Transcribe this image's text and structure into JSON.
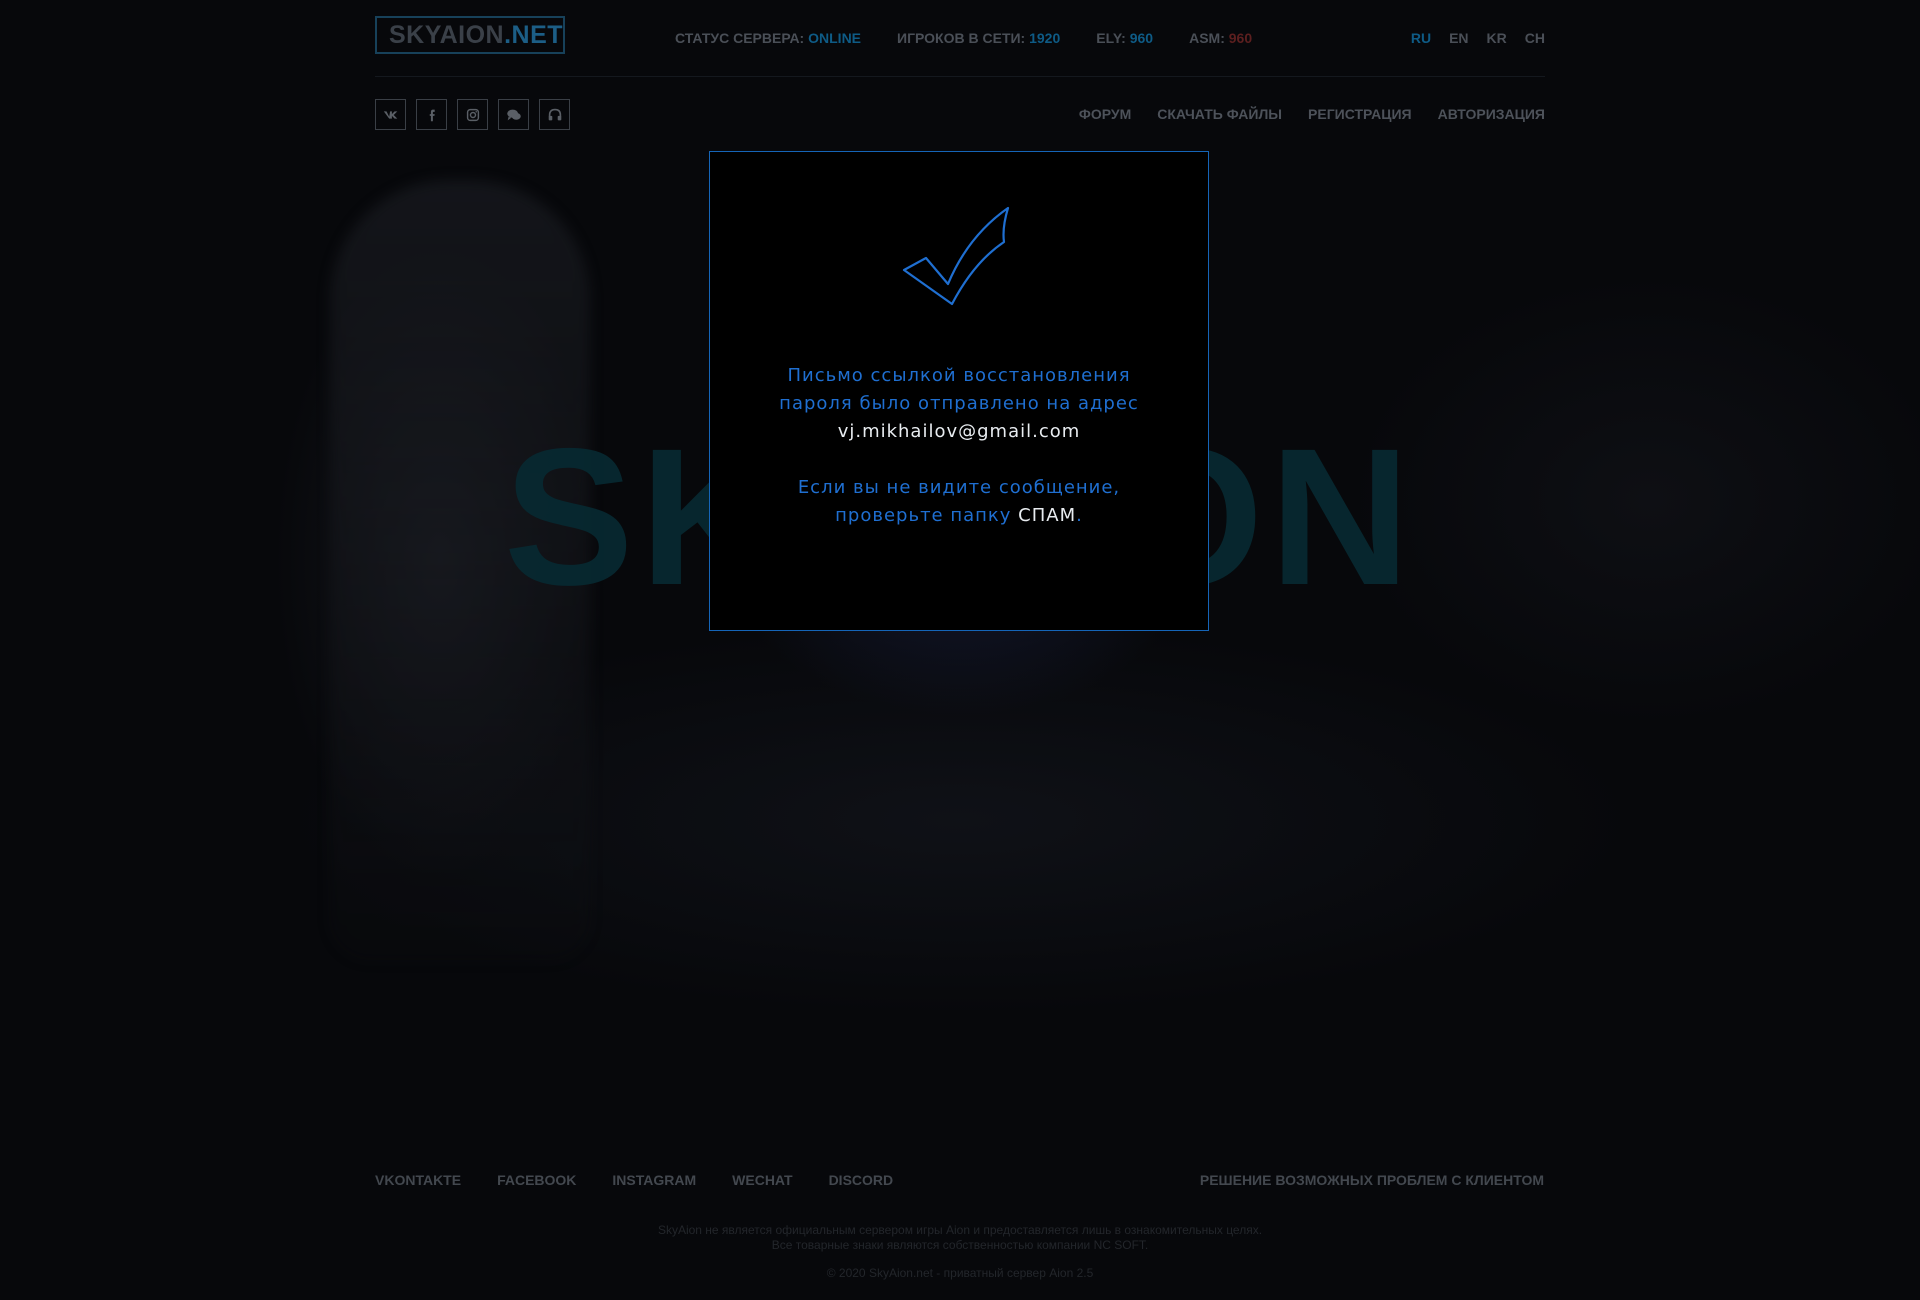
{
  "background": {
    "wordmark": "SKYAION"
  },
  "header": {
    "logo": {
      "main": "SKYAION",
      "suffix": ".NET"
    },
    "status": [
      {
        "label": "СТАТУС СЕРВЕРА:",
        "value": "ONLINE"
      },
      {
        "label": "ИГРОКОВ В СЕТИ:",
        "value": "1920"
      },
      {
        "label": "ELY:",
        "value": "960"
      },
      {
        "label": "ASM:",
        "value": "960"
      }
    ],
    "languages": [
      "RU",
      "EN",
      "KR",
      "CH"
    ],
    "active_language": "RU"
  },
  "social_icons": [
    {
      "name": "vk-icon",
      "glyph": "vk"
    },
    {
      "name": "facebook-icon",
      "glyph": "f"
    },
    {
      "name": "instagram-icon",
      "glyph": ""
    },
    {
      "name": "chat-icon",
      "glyph": ""
    },
    {
      "name": "headset-icon",
      "glyph": ""
    }
  ],
  "nav": [
    "ФОРУМ",
    "СКАЧАТЬ ФАЙЛЫ",
    "РЕГИСТРАЦИЯ",
    "АВТОРИЗАЦИЯ"
  ],
  "modal": {
    "line1": "Письмо ссылкой восстановления",
    "line2": "пароля было отправлено на адрес",
    "email": "vj.mikhailov@gmail.com",
    "line3": "Если вы не видите сообщение,",
    "line4_prefix": "проверьте папку ",
    "line4_highlight": "СПАМ",
    "line4_suffix": ".",
    "accent_color": "#1f6fd1"
  },
  "footer": {
    "links": [
      "VKONTAKTE",
      "FACEBOOK",
      "INSTAGRAM",
      "WECHAT",
      "DISCORD"
    ],
    "support_link": "РЕШЕНИЕ ВОЗМОЖНЫХ ПРОБЛЕМ С КЛИЕНТОМ",
    "disclaimer1": "SkyAion не является официальным сервером игры Aion и предоставляется лишь в ознакомительных целях.",
    "disclaimer2": "Все товарные знаки являются собственностью компании NC SOFT.",
    "copyright": "© 2020 SkyAion.net - приватный сервер Aion 2.5"
  }
}
